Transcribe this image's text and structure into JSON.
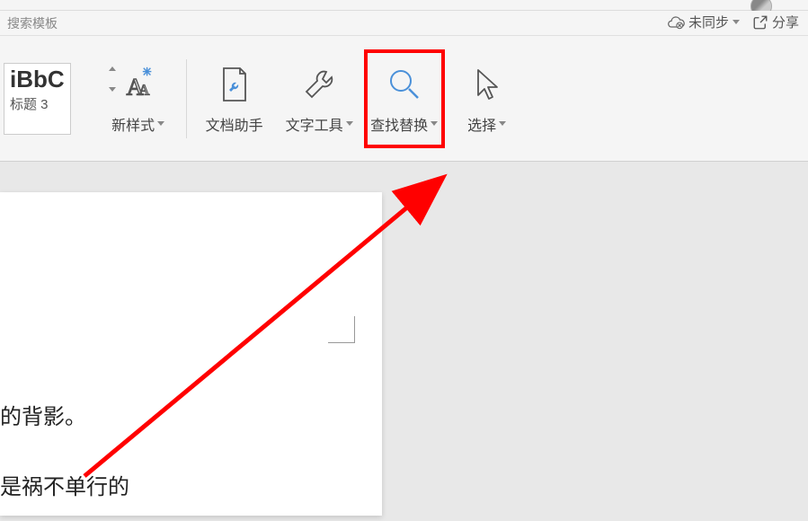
{
  "search": {
    "placeholder": "搜索模板"
  },
  "right_actions": {
    "sync": "未同步",
    "share": "分享"
  },
  "style_gallery": {
    "preview": "iBbC",
    "label": "标题 3"
  },
  "toolbar": {
    "new_style": "新样式",
    "doc_helper": "文档助手",
    "text_tool": "文字工具",
    "find_replace": "查找替换",
    "select": "选择"
  },
  "document": {
    "line1": "的背影。",
    "line2": "是祸不单行的"
  }
}
